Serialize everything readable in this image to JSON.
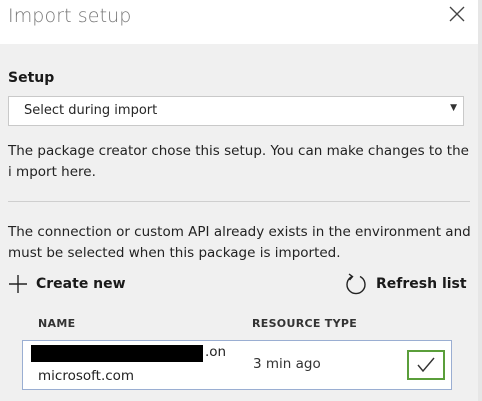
{
  "dialog": {
    "title": "Import setup"
  },
  "setup": {
    "label": "Setup",
    "selected": "Select during import",
    "description": "The package creator chose this setup. You can make changes to the i mport here."
  },
  "connection": {
    "info": "The connection or custom API already exists in the environment and must be selected when this package is imported."
  },
  "actions": {
    "create_new": "Create new",
    "refresh_list": "Refresh list"
  },
  "table": {
    "columns": [
      "NAME",
      "RESOURCE TYPE"
    ],
    "rows": [
      {
        "name_tail": ".on",
        "name_line2": "microsoft.com",
        "time": "3 min ago",
        "selected": true
      }
    ]
  },
  "icons": {
    "close": "close-icon",
    "dropdown": "chevron-down-icon",
    "add": "plus-icon",
    "refresh": "refresh-icon",
    "check": "checkmark-icon"
  },
  "colors": {
    "selected_border": "#5a9e3a",
    "row_border": "#9aaed2"
  }
}
